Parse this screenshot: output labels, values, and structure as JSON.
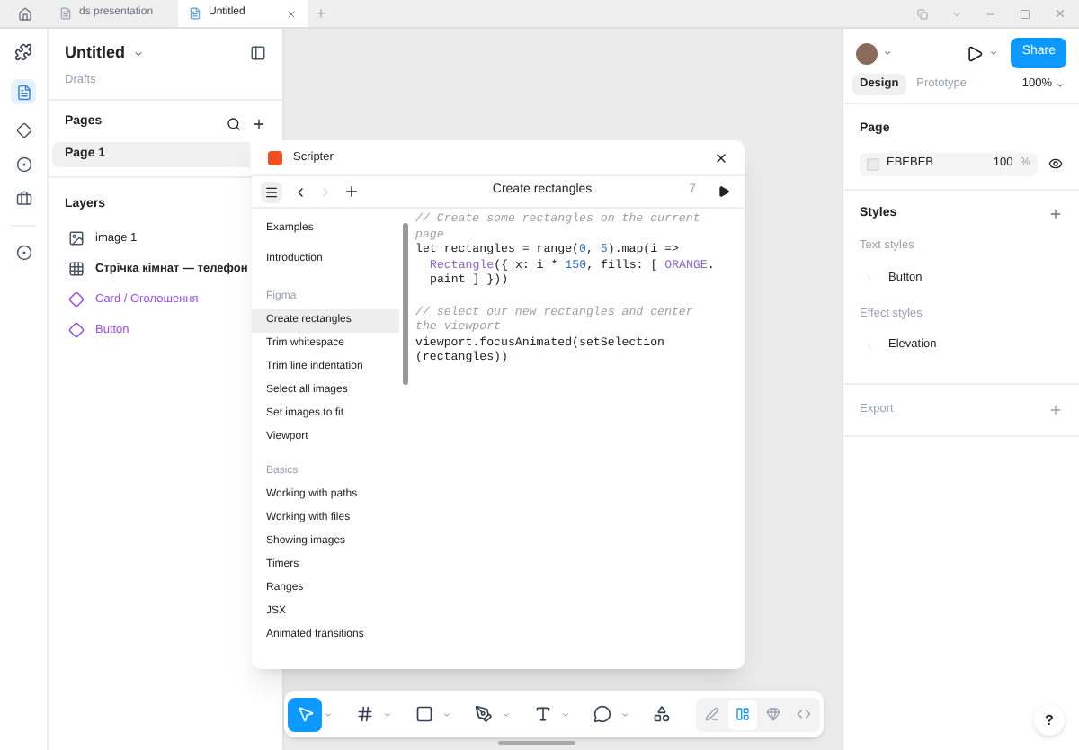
{
  "tabs": [
    {
      "label": "ds presentation",
      "selected": false
    },
    {
      "label": "Untitled",
      "selected": true
    }
  ],
  "file": {
    "title": "Untitled",
    "location": "Drafts"
  },
  "pages": {
    "title": "Pages",
    "items": [
      {
        "label": "Page 1",
        "selected": true
      }
    ]
  },
  "layers": {
    "title": "Layers",
    "items": [
      {
        "label": "image 1",
        "kind": "image"
      },
      {
        "label": "Стрічка кімнат — телефон",
        "kind": "frame"
      },
      {
        "label": "Card / Оголошення",
        "kind": "component"
      },
      {
        "label": "Button",
        "kind": "component"
      }
    ]
  },
  "scripter": {
    "title": "Scripter",
    "script_title": "Create rectangles",
    "line_hint": "7",
    "menu": [
      {
        "label": "Examples",
        "kind": "item",
        "selected": false
      },
      {
        "label": "Introduction",
        "kind": "item",
        "selected": false
      },
      {
        "label": "Figma",
        "kind": "heading"
      },
      {
        "label": "Create rectangles",
        "kind": "item",
        "selected": true
      },
      {
        "label": "Trim whitespace",
        "kind": "item",
        "selected": false
      },
      {
        "label": "Trim line indentation",
        "kind": "item",
        "selected": false
      },
      {
        "label": "Select all images",
        "kind": "item",
        "selected": false
      },
      {
        "label": "Set images to fit",
        "kind": "item",
        "selected": false
      },
      {
        "label": "Viewport",
        "kind": "item",
        "selected": false
      },
      {
        "label": "Basics",
        "kind": "heading"
      },
      {
        "label": "Working with paths",
        "kind": "item",
        "selected": false
      },
      {
        "label": "Working with files",
        "kind": "item",
        "selected": false
      },
      {
        "label": "Showing images",
        "kind": "item",
        "selected": false
      },
      {
        "label": "Timers",
        "kind": "item",
        "selected": false
      },
      {
        "label": "Ranges",
        "kind": "item",
        "selected": false
      },
      {
        "label": "JSX",
        "kind": "item",
        "selected": false
      },
      {
        "label": "Animated transitions",
        "kind": "item",
        "selected": false
      }
    ],
    "code": [
      {
        "indent": false,
        "gap_before": false,
        "segments": [
          {
            "kind": "comment",
            "text": "// Create some rectangles on the current"
          }
        ]
      },
      {
        "indent": false,
        "gap_before": false,
        "segments": [
          {
            "kind": "comment",
            "text": "page"
          }
        ]
      },
      {
        "indent": false,
        "gap_before": false,
        "segments": [
          {
            "kind": "plain",
            "text": "let rectangles = range("
          },
          {
            "kind": "number",
            "text": "0"
          },
          {
            "kind": "plain",
            "text": ", "
          },
          {
            "kind": "number",
            "text": "5"
          },
          {
            "kind": "plain",
            "text": ").map(i =>"
          }
        ]
      },
      {
        "indent": true,
        "gap_before": false,
        "segments": [
          {
            "kind": "type",
            "text": "Rectangle"
          },
          {
            "kind": "plain",
            "text": "({ x: i * "
          },
          {
            "kind": "number",
            "text": "150"
          },
          {
            "kind": "plain",
            "text": ", fills: [ "
          },
          {
            "kind": "type",
            "text": "ORANGE"
          },
          {
            "kind": "plain",
            "text": "."
          }
        ]
      },
      {
        "indent": true,
        "gap_before": false,
        "segments": [
          {
            "kind": "plain",
            "text": "paint ] }))"
          }
        ]
      },
      {
        "indent": false,
        "gap_before": true,
        "segments": [
          {
            "kind": "comment",
            "text": "// select our new rectangles and center"
          }
        ]
      },
      {
        "indent": false,
        "gap_before": false,
        "segments": [
          {
            "kind": "comment",
            "text": "the viewport"
          }
        ]
      },
      {
        "indent": false,
        "gap_before": false,
        "segments": [
          {
            "kind": "plain",
            "text": "viewport.focusAnimated(setSelection"
          }
        ]
      },
      {
        "indent": false,
        "gap_before": false,
        "segments": [
          {
            "kind": "plain",
            "text": "(rectangles))"
          }
        ]
      }
    ]
  },
  "right_panel": {
    "tabs": [
      {
        "label": "Design",
        "selected": true
      },
      {
        "label": "Prototype",
        "selected": false
      }
    ],
    "zoom": "100%",
    "share": "Share",
    "page_section": {
      "title": "Page",
      "color_value": "EBEBEB",
      "opacity": "100",
      "unit": "%"
    },
    "styles": {
      "title": "Styles",
      "groups": [
        {
          "title": "Text styles",
          "items": [
            "Button"
          ]
        },
        {
          "title": "Effect styles",
          "items": [
            "Elevation"
          ]
        }
      ]
    },
    "export": {
      "title": "Export"
    }
  },
  "toolbar": {
    "tools": [
      {
        "kind": "move",
        "selected": true
      },
      {
        "kind": "frame",
        "selected": false
      },
      {
        "kind": "rectangle",
        "selected": false
      },
      {
        "kind": "pen",
        "selected": false
      },
      {
        "kind": "text",
        "selected": false
      },
      {
        "kind": "comment",
        "selected": false
      },
      {
        "kind": "actions",
        "selected": false
      }
    ],
    "modes": [
      {
        "kind": "draw",
        "selected": false
      },
      {
        "kind": "design",
        "selected": true
      },
      {
        "kind": "prototype",
        "selected": false
      },
      {
        "kind": "dev",
        "selected": false
      }
    ]
  },
  "help": "?"
}
